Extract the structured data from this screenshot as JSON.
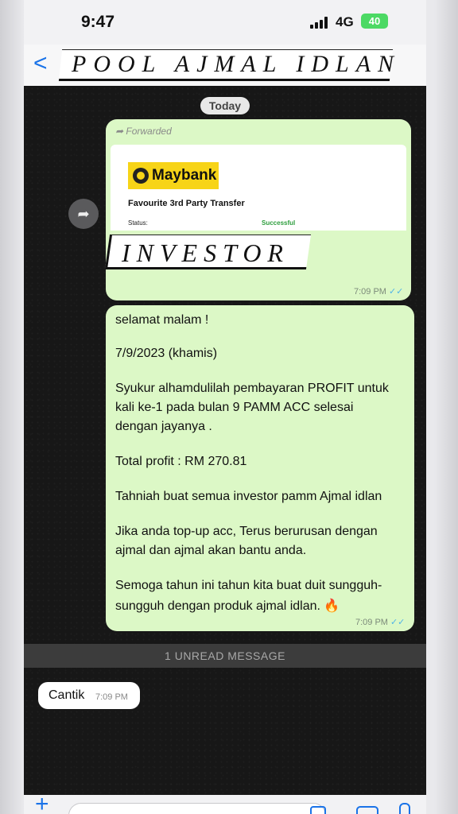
{
  "status_bar": {
    "time": "9:47",
    "network": "4G",
    "battery": "40"
  },
  "header": {
    "back_glyph": "<",
    "title": "POOL AJMAL IDLAN"
  },
  "chat": {
    "date_label": "Today",
    "forwarded_message": {
      "forwarded_label": "Forwarded",
      "bank_name": "Maybank",
      "card_title": "Favourite 3rd Party Transfer",
      "status_label": "Status:",
      "status_value": "Successful",
      "overlay_text": "INVESTOR",
      "time": "7:09 PM"
    },
    "text_message": {
      "lines": [
        "selamat malam !",
        "7/9/2023 (khamis)",
        "Syukur alhamdulilah pembayaran PROFIT untuk",
        "kali ke-1 pada bulan 9 PAMM ACC selesai",
        "dengan jayanya .",
        "Total profit : RM 270.81",
        "Tahniah buat semua investor pamm Ajmal idlan",
        "Jika anda top-up acc, Terus berurusan dengan",
        "ajmal dan ajmal akan bantu anda.",
        "Semoga tahun ini tahun kita buat duit sungguh-",
        "sungguh dengan produk ajmal idlan. 🔥"
      ],
      "time": "7:09 PM"
    },
    "unread_label": "1 UNREAD MESSAGE",
    "incoming_message": {
      "text": "Cantik",
      "time": "7:09 PM"
    }
  },
  "colors": {
    "outgoing_bubble": "#dcf8c6",
    "chat_bg": "#171717",
    "accent": "#1a73e8",
    "read_tick": "#4fb4e8"
  },
  "icons": [
    "back-icon",
    "forward-icon",
    "read-receipt-icon",
    "plus-icon",
    "sticker-icon",
    "camera-icon",
    "mic-icon"
  ]
}
